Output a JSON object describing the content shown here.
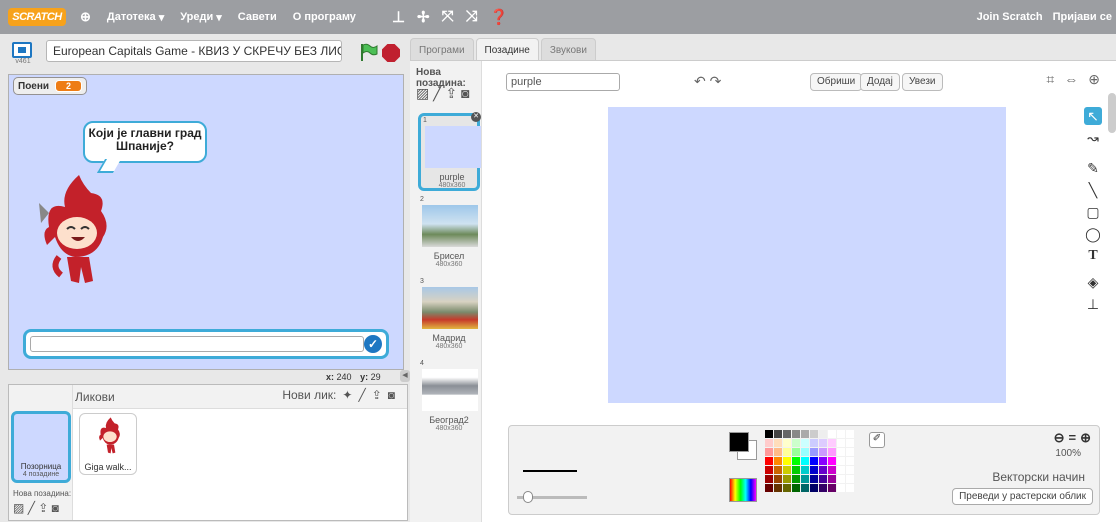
{
  "menubar": {
    "logo": "SCRATCH",
    "file": "Датотека",
    "edit": "Уреди",
    "tips": "Савети",
    "about": "О програму",
    "join": "Join Scratch",
    "signin": "Пријави се"
  },
  "stage": {
    "version": "v461",
    "title": "European Capitals Game - КВИЗ У СКРЕЧУ БЕЗ ЛИСТИ",
    "var_name": "Поени",
    "var_value": "2",
    "speech": "Који је главни град Шпаније?",
    "coord_x_label": "x:",
    "coord_x": "240",
    "coord_y_label": "y:",
    "coord_y": "29"
  },
  "sprites": {
    "title": "Ликови",
    "new_sprite": "Нови лик:",
    "stage_label": "Позорница",
    "stage_count": "4 позадине",
    "new_backdrop": "Нова позадина:",
    "sprite_name": "Giga walk..."
  },
  "tabs": [
    "Програми",
    "Позадине",
    "Звукови"
  ],
  "backdrops": {
    "header": "Нова позадина:",
    "items": [
      {
        "num": "1",
        "name": "purple",
        "size": "480x360"
      },
      {
        "num": "2",
        "name": "Брисел",
        "size": "480x360"
      },
      {
        "num": "3",
        "name": "Мадрид",
        "size": "480x360"
      },
      {
        "num": "4",
        "name": "Београд2",
        "size": "480x360"
      }
    ]
  },
  "editor": {
    "name_value": "purple",
    "clear": "Обриши",
    "add": "Додај",
    "import": "Увези",
    "zoom_pct": "100%",
    "mode": "Векторски начин",
    "convert": "Преведи у растерски облик"
  },
  "colors": {
    "accent": "#3eabd8",
    "canvas": "#cdd8ff",
    "var_orange": "#ee7d16",
    "stop": "#c0202f"
  }
}
